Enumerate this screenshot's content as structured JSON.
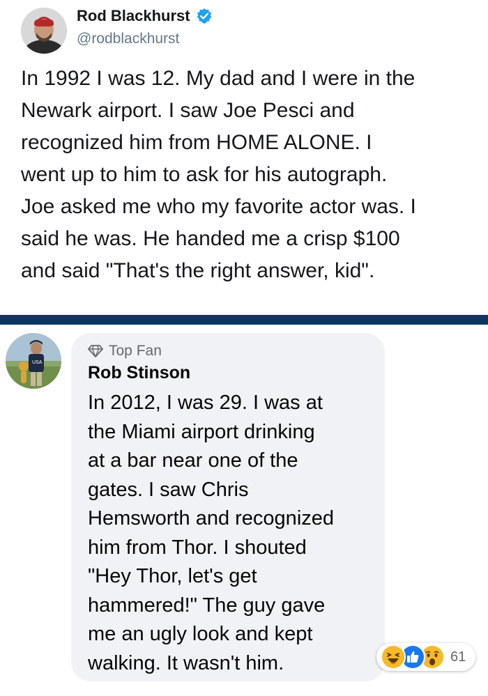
{
  "tweet": {
    "author_name": "Rod Blackhurst",
    "author_handle": "@rodblackhurst",
    "lines": [
      "In 1992 I was 12. My dad and I were in the",
      "Newark airport. I saw Joe Pesci and",
      "recognized him from HOME ALONE. I",
      "went up to him to ask for his autograph.",
      "Joe asked me who my favorite actor was. I",
      "said he was. He handed me a crisp $100",
      "and said \"That's the right answer, kid\"."
    ]
  },
  "comment": {
    "badge_label": "Top Fan",
    "author_name": "Rob Stinson",
    "lines": [
      "In 2012, I was 29. I was at",
      "the Miami airport drinking",
      "at a bar near one of the",
      "gates. I saw Chris",
      "Hemsworth and recognized",
      "him from Thor. I shouted",
      "\"Hey Thor, let's get",
      "hammered!\" The guy gave",
      "me an ugly look and kept",
      "walking. It wasn't him."
    ],
    "reactions": {
      "icons": [
        "haha-icon",
        "like-icon",
        "wow-icon"
      ],
      "count": "61"
    }
  },
  "colors": {
    "divider": "#0b3861",
    "verified": "#1da1f2",
    "like": "#1877f2",
    "reaction_yellow": "#f7b928",
    "bubble": "#f0f2f5"
  }
}
